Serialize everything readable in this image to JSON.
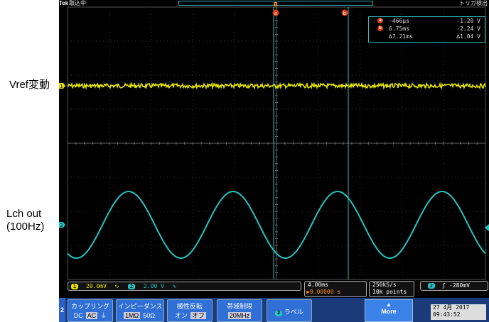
{
  "annotations": {
    "vref_label": "Vref変動",
    "lch_label_line1": "Lch out",
    "lch_label_line2": "(100Hz)"
  },
  "scope": {
    "brand": "Tek",
    "acq_status": "取込中",
    "trigger_status": "トリガ検出",
    "cursor_a_tag": "a",
    "cursor_b_tag": "b",
    "trig_marker_tag": "T",
    "ch1_ground_tag": "1",
    "ch2_ground_tag": "2",
    "readout": {
      "a_time": "-466µs",
      "a_volt": "-1.20 V",
      "b_time": "6.75ms",
      "b_volt": "-2.24 V",
      "delta_time": "∆7.21ms",
      "delta_volt": "∆1.04 V"
    },
    "ch1": {
      "num": "1",
      "scale": "20.0mV",
      "bw_symbol": "∿",
      "color": "#e3e300"
    },
    "ch2": {
      "num": "2",
      "scale": "2.00 V",
      "bw_symbol": "∿",
      "color": "#23c4c4"
    },
    "horizontal": {
      "time_div": "4.00ms",
      "trigger_pos": "▶0.00000 s"
    },
    "acquisition": {
      "sample_rate": "250kS/s",
      "record_length": "10k points"
    },
    "trigger": {
      "source": "2",
      "slope_symbol": "ʃ",
      "level": "-280mV"
    },
    "menu": {
      "channel_tab": "2",
      "coupling_title": "カップリング",
      "coupling_opts": [
        "DC",
        "AC",
        "⏚"
      ],
      "impedance_title": "インピーダンス",
      "impedance_opts": [
        "1MΩ",
        "50Ω"
      ],
      "invert_title": "極性反転",
      "invert_opts": [
        "オン",
        "オフ"
      ],
      "bw_title": "帯域制限",
      "bw_value": "20MHz",
      "label_num": "2",
      "label_btn": "ラベル",
      "more_btn": "More"
    },
    "datetime": {
      "date": "27 4月 2017",
      "time": "09:43:52"
    }
  }
}
